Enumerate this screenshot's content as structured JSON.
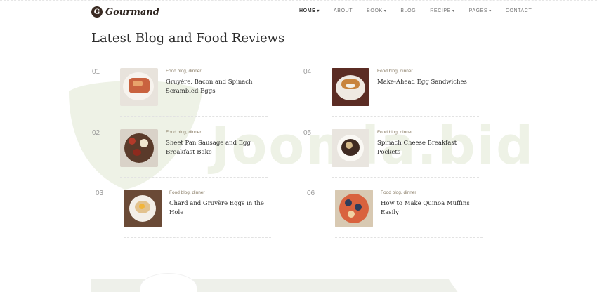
{
  "brand": {
    "name": "Gourmand",
    "mark": "G"
  },
  "nav": [
    {
      "label": "HOME",
      "dropdown": true,
      "active": true
    },
    {
      "label": "ABOUT",
      "dropdown": false,
      "active": false
    },
    {
      "label": "BOOK",
      "dropdown": true,
      "active": false
    },
    {
      "label": "BLOG",
      "dropdown": false,
      "active": false
    },
    {
      "label": "RECIPE",
      "dropdown": true,
      "active": false
    },
    {
      "label": "PAGES",
      "dropdown": true,
      "active": false
    },
    {
      "label": "CONTACT",
      "dropdown": false,
      "active": false
    }
  ],
  "section_title": "Latest Blog and Food Reviews",
  "watermark": "Joomla.bid",
  "posts": [
    {
      "num": "01",
      "meta": "Food blog, dinner",
      "title": "Gruyère, Bacon and Spinach Scrambled Eggs"
    },
    {
      "num": "02",
      "meta": "Food blog, dinner",
      "title": "Sheet Pan Sausage and Egg Breakfast Bake"
    },
    {
      "num": "03",
      "meta": "Food blog, dinner",
      "title": "Chard and Gruyère Eggs in the Hole"
    },
    {
      "num": "04",
      "meta": "Food blog, dinner",
      "title": "Make-Ahead Egg Sandwiches"
    },
    {
      "num": "05",
      "meta": "Food blog, dinner",
      "title": "Spinach Cheese Breakfast Pockets"
    },
    {
      "num": "06",
      "meta": "Food blog, dinner",
      "title": "How to Make Quinoa Muffins Easily"
    }
  ],
  "colors": {
    "accent": "#8a7d66",
    "text": "#2c2c2c",
    "watermark": "#eef2e6"
  }
}
